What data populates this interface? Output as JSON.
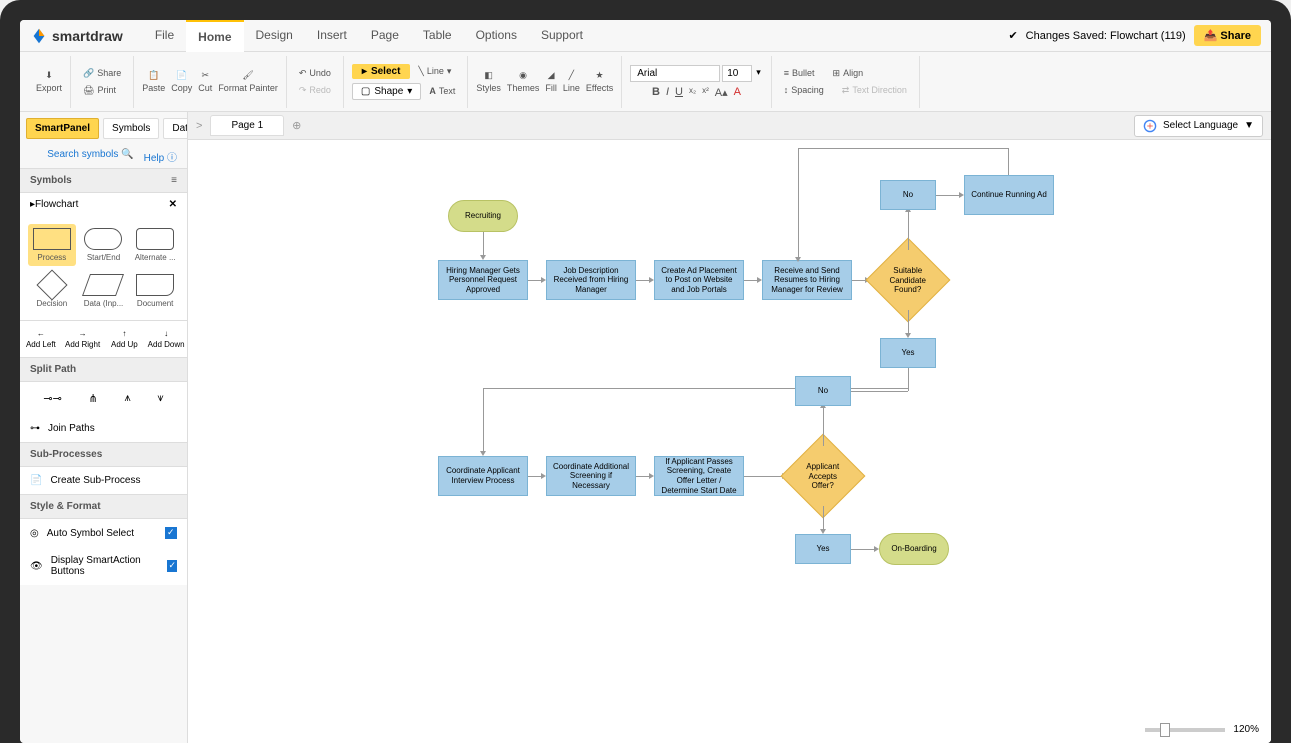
{
  "app": {
    "name": "smartdraw"
  },
  "menu": [
    "File",
    "Home",
    "Design",
    "Insert",
    "Page",
    "Table",
    "Options",
    "Support"
  ],
  "active_menu": "Home",
  "status": {
    "saved": "Changes Saved: Flowchart (119)",
    "share": "Share"
  },
  "ribbon": {
    "export": "Export",
    "share": "Share",
    "print": "Print",
    "paste": "Paste",
    "copy": "Copy",
    "cut": "Cut",
    "format_painter": "Format Painter",
    "undo": "Undo",
    "redo": "Redo",
    "select": "Select",
    "shape": "Shape",
    "line": "Line",
    "text": "Text",
    "styles": "Styles",
    "themes": "Themes",
    "fill": "Fill",
    "line2": "Line",
    "effects": "Effects",
    "font": "Arial",
    "size": "10",
    "bullet": "Bullet",
    "align": "Align",
    "spacing": "Spacing",
    "direction": "Text Direction"
  },
  "panel": {
    "tabs": [
      "SmartPanel",
      "Symbols",
      "Data"
    ],
    "active_tab": "SmartPanel",
    "search": "Search symbols",
    "help": "Help",
    "symbols_header": "Symbols",
    "flowchart_header": "Flowchart",
    "shapes": [
      "Process",
      "Start/End",
      "Alternate ...",
      "Decision",
      "Data (Inp...",
      "Document"
    ],
    "add": [
      "Add Left",
      "Add Right",
      "Add Up",
      "Add Down"
    ],
    "split_header": "Split Path",
    "join": "Join Paths",
    "sub_header": "Sub-Processes",
    "create_sub": "Create Sub-Process",
    "style_header": "Style & Format",
    "auto_symbol": "Auto Symbol Select",
    "smart_action": "Display SmartAction Buttons"
  },
  "page": {
    "tab": "Page 1",
    "lang": "Select Language",
    "zoom": "120%"
  },
  "flow": {
    "recruiting": "Recruiting",
    "n1": "Hiring Manager Gets Personnel Request Approved",
    "n2": "Job Description Received from Hiring Manager",
    "n3": "Create Ad Placement to Post on Website and Job Portals",
    "n4": "Receive and Send Resumes to Hiring Manager for Review",
    "d1": "Suitable Candidate Found?",
    "no": "No",
    "yes": "Yes",
    "n5": "Continue Running Ad",
    "n6": "Coordinate Applicant Interview Process",
    "n7": "Coordinate Additional Screening if Necessary",
    "n8": "If Applicant Passes Screening, Create Offer Letter / Determine Start Date",
    "d2": "Applicant Accepts Offer?",
    "onboard": "On-Boarding"
  }
}
